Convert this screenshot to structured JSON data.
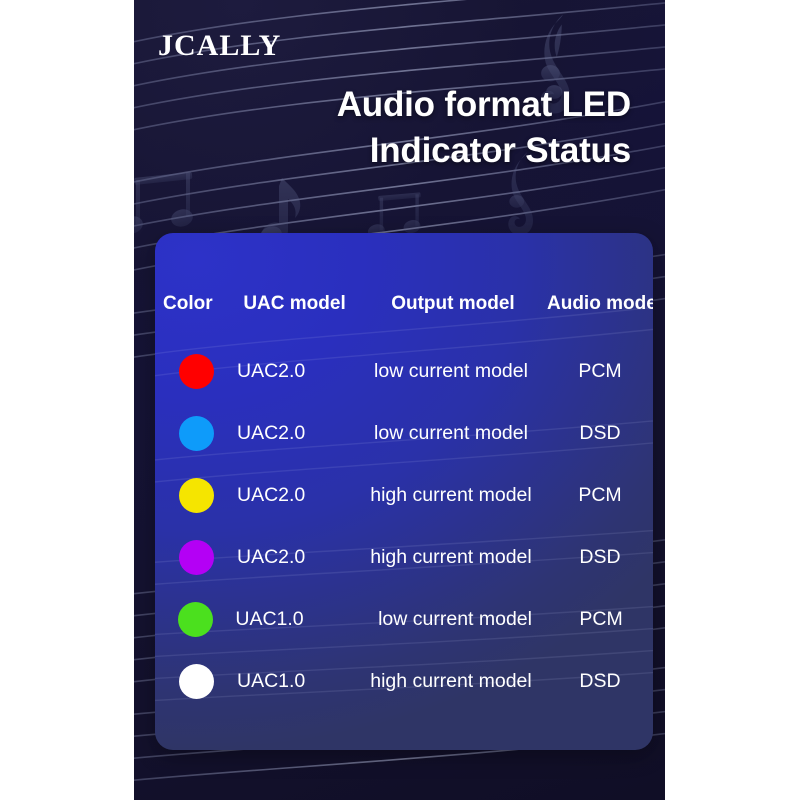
{
  "brand": {
    "logo_text": "JCALLY"
  },
  "header": {
    "title_line1": "Audio format LED",
    "title_line2": "Indicator Status"
  },
  "card": {
    "columns": [
      "Color",
      "UAC model",
      "Output model",
      "Audio model"
    ],
    "rows": [
      {
        "color_name": "red-led",
        "color_hex": "#FF0000",
        "uac": "UAC2.0",
        "output": "low current model",
        "audio": "PCM"
      },
      {
        "color_name": "blue-led",
        "color_hex": "#0E9BFA",
        "uac": "UAC2.0",
        "output": "low current model",
        "audio": "DSD"
      },
      {
        "color_name": "yellow-led",
        "color_hex": "#F5E500",
        "uac": "UAC2.0",
        "output": "high current model",
        "audio": "PCM"
      },
      {
        "color_name": "purple-led",
        "color_hex": "#B400F5",
        "uac": "UAC2.0",
        "output": "high current model",
        "audio": "DSD"
      },
      {
        "color_name": "green-led",
        "color_hex": "#4BE01E",
        "uac": "UAC1.0",
        "output": "low current model",
        "audio": "PCM"
      },
      {
        "color_name": "white-led",
        "color_hex": "#FFFFFF",
        "uac": "UAC1.0",
        "output": "high current model",
        "audio": "DSD"
      }
    ]
  },
  "theme": {
    "panel_dark": "#15133A",
    "card_blue": "#2A2FBE",
    "card_blue_dark": "#2F3566",
    "text_white": "#FFFFFF",
    "page_background": "#FFFFFF"
  },
  "decor": {
    "treble_clef": "treble-clef-icon",
    "eighth_note": "eighth-note-icon",
    "beamed_notes": "beamed-notes-icon",
    "staff_lines": "staff-lines-decor"
  }
}
